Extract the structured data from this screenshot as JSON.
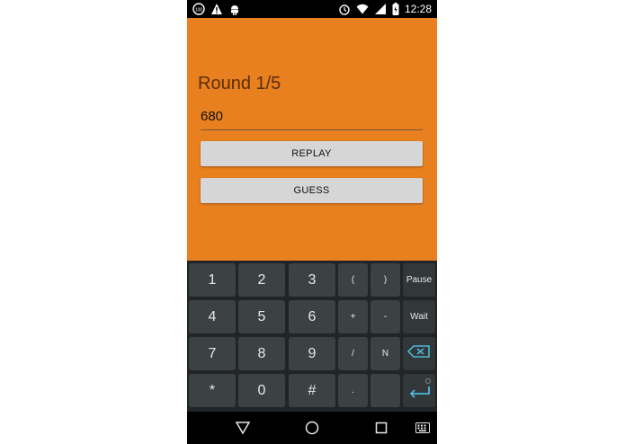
{
  "status_bar": {
    "time": "12:28",
    "left_icons": [
      "notification-icon",
      "warning-icon",
      "android-icon"
    ],
    "right_icons": [
      "alarm-icon",
      "wifi-icon",
      "signal-icon",
      "battery-icon"
    ]
  },
  "app": {
    "round_label": "Round 1/5",
    "input_value": "680",
    "replay_label": "REPLAY",
    "guess_label": "GUESS",
    "background_color": "#e8801f"
  },
  "keyboard": {
    "rows": [
      [
        "1",
        "2",
        "3",
        "(",
        ")",
        "Pause"
      ],
      [
        "4",
        "5",
        "6",
        "+",
        "-",
        "Wait"
      ],
      [
        "7",
        "8",
        "9",
        "/",
        "N",
        ""
      ],
      [
        "*",
        "0",
        "#",
        ".",
        "",
        ""
      ]
    ],
    "backspace_icon": "backspace-icon",
    "enter_icon": "enter-icon"
  },
  "nav_bar": {
    "icons": [
      "back-icon",
      "home-icon",
      "recents-icon",
      "keyboard-switch-icon"
    ]
  }
}
